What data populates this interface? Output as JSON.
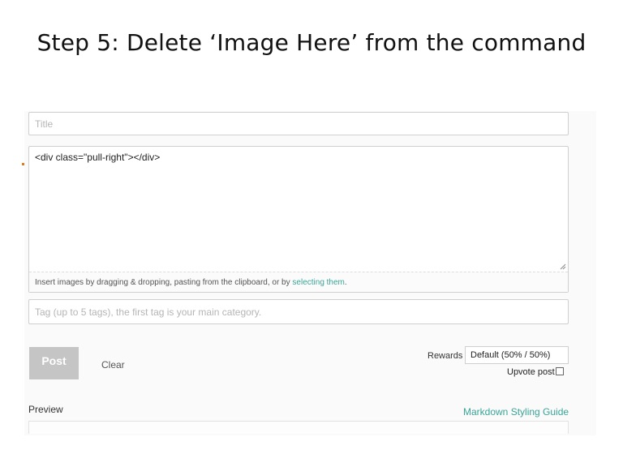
{
  "slide": {
    "title": "Step 5: Delete ‘Image Here’ from the command"
  },
  "editor": {
    "title_placeholder": "Title",
    "body_text": "<div class=\"pull-right\"></div>",
    "insert_text_prefix": "Insert images by dragging & dropping, pasting from the clipboard, or by ",
    "insert_link": "selecting them",
    "insert_text_suffix": ".",
    "tag_placeholder": "Tag (up to 5 tags), the first tag is your main category.",
    "post_label": "Post",
    "clear_label": "Clear",
    "rewards_label": "Rewards",
    "rewards_value": "Default (50% / 50%)",
    "upvote_label": "Upvote post",
    "upvote_checked": false,
    "preview_label": "Preview",
    "styling_link": "Markdown Styling Guide"
  },
  "colors": {
    "accent_link": "#3aa597",
    "underline_mark": "#e07a1f",
    "post_button_bg": "#c5c5c5"
  },
  "icons": {
    "resize": "resize-grip-icon"
  }
}
